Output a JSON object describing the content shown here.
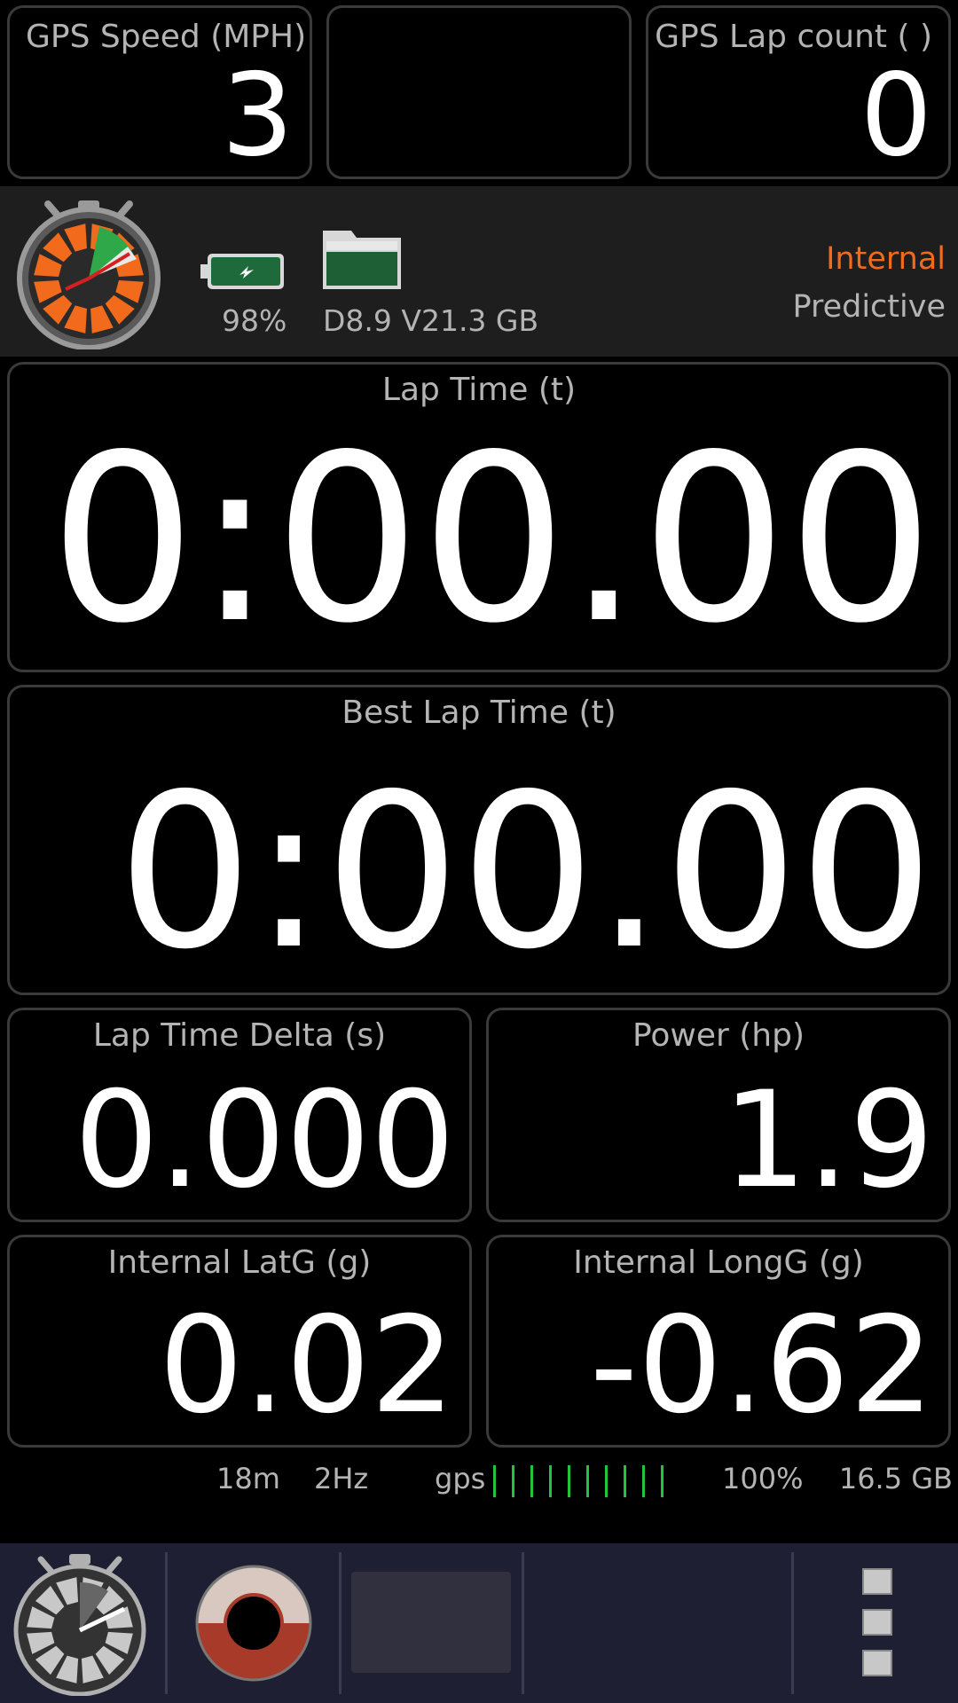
{
  "tiles": {
    "gps_speed": {
      "label": "GPS Speed (MPH)",
      "value": "3"
    },
    "gps_lap_count": {
      "label": "GPS Lap count ( )",
      "value": "0"
    },
    "lap_time": {
      "label": "Lap Time (t)",
      "value": "0:00.00"
    },
    "best_lap_time": {
      "label": "Best Lap Time (t)",
      "value": "0:00.00"
    },
    "lap_time_delta": {
      "label": "Lap Time Delta (s)",
      "value": "0.000"
    },
    "power": {
      "label": "Power (hp)",
      "value": "1.9"
    },
    "internal_latg": {
      "label": "Internal LatG (g)",
      "value": "0.02"
    },
    "internal_longg": {
      "label": "Internal LongG (g)",
      "value": "-0.62"
    }
  },
  "status": {
    "battery_percent": "98%",
    "storage_text": "D8.9 V21.3 GB",
    "source": "Internal",
    "mode": "Predictive",
    "source_color": "#f26a1b",
    "battery_color": "#1f6a3a",
    "folder_color": "#1f5f35"
  },
  "info_bar": {
    "accuracy": "18m",
    "rate": "2Hz",
    "gps_label": "gps",
    "gps_signal_bars": 10,
    "gps_bar_color": "#22c53a",
    "percent": "100%",
    "storage": "16.5 GB"
  },
  "nav": {
    "icons": [
      "stopwatch-icon",
      "record-icon",
      "blank-panel",
      "menu-icon"
    ]
  }
}
